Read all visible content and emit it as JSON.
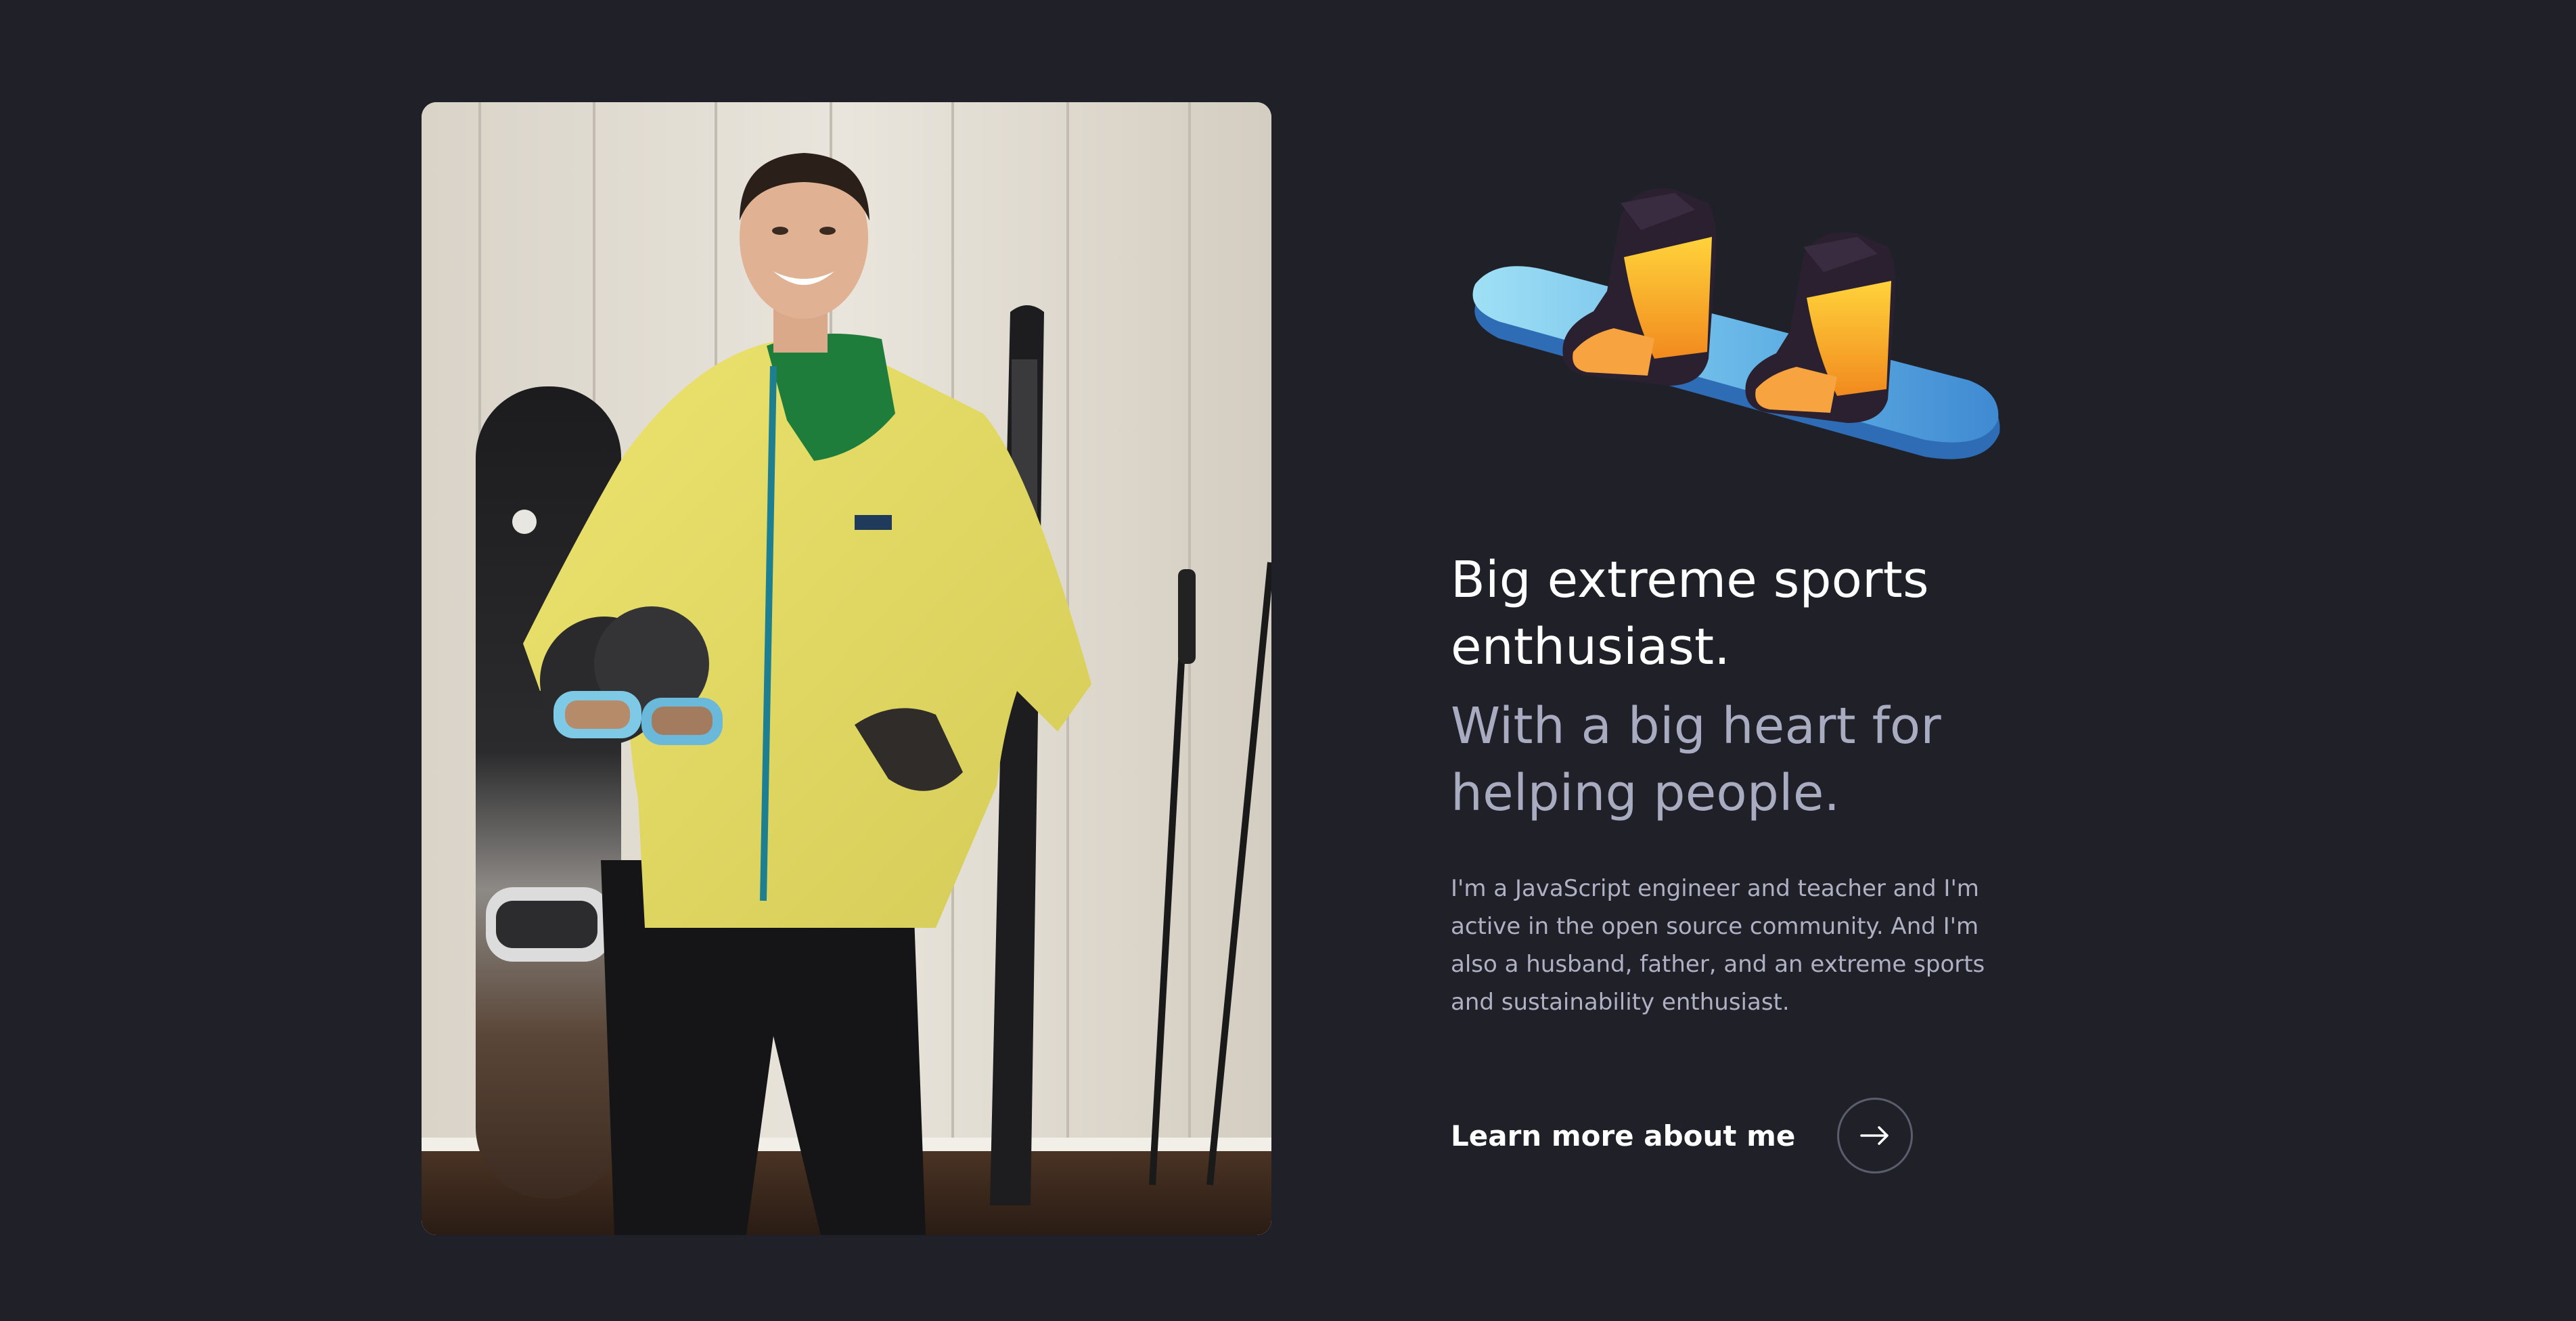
{
  "hero": {
    "photo_alt": "Person in a yellow ski jacket holding a helmet, standing in front of a snowboard and skis",
    "headline": "Big extreme sports enthusiast.",
    "subheadline": "With a big heart for helping people.",
    "paragraph": "I'm a JavaScript engineer and teacher and I'm active in the open source community. And I'm also a husband, father, and an extreme sports and sustainability enthusiast.",
    "cta_label": "Learn more about me",
    "cta_icon": "arrow-right-icon",
    "illustration": "snowboard-boots-illustration"
  },
  "colors": {
    "background": "#1f2028",
    "headline": "#ffffff",
    "subheadline": "#a9acc0",
    "body_text": "#aeb1c4",
    "jacket": "#e6dc6a",
    "board": "#5aa7dd",
    "boot_accent": "#f4a62a"
  }
}
